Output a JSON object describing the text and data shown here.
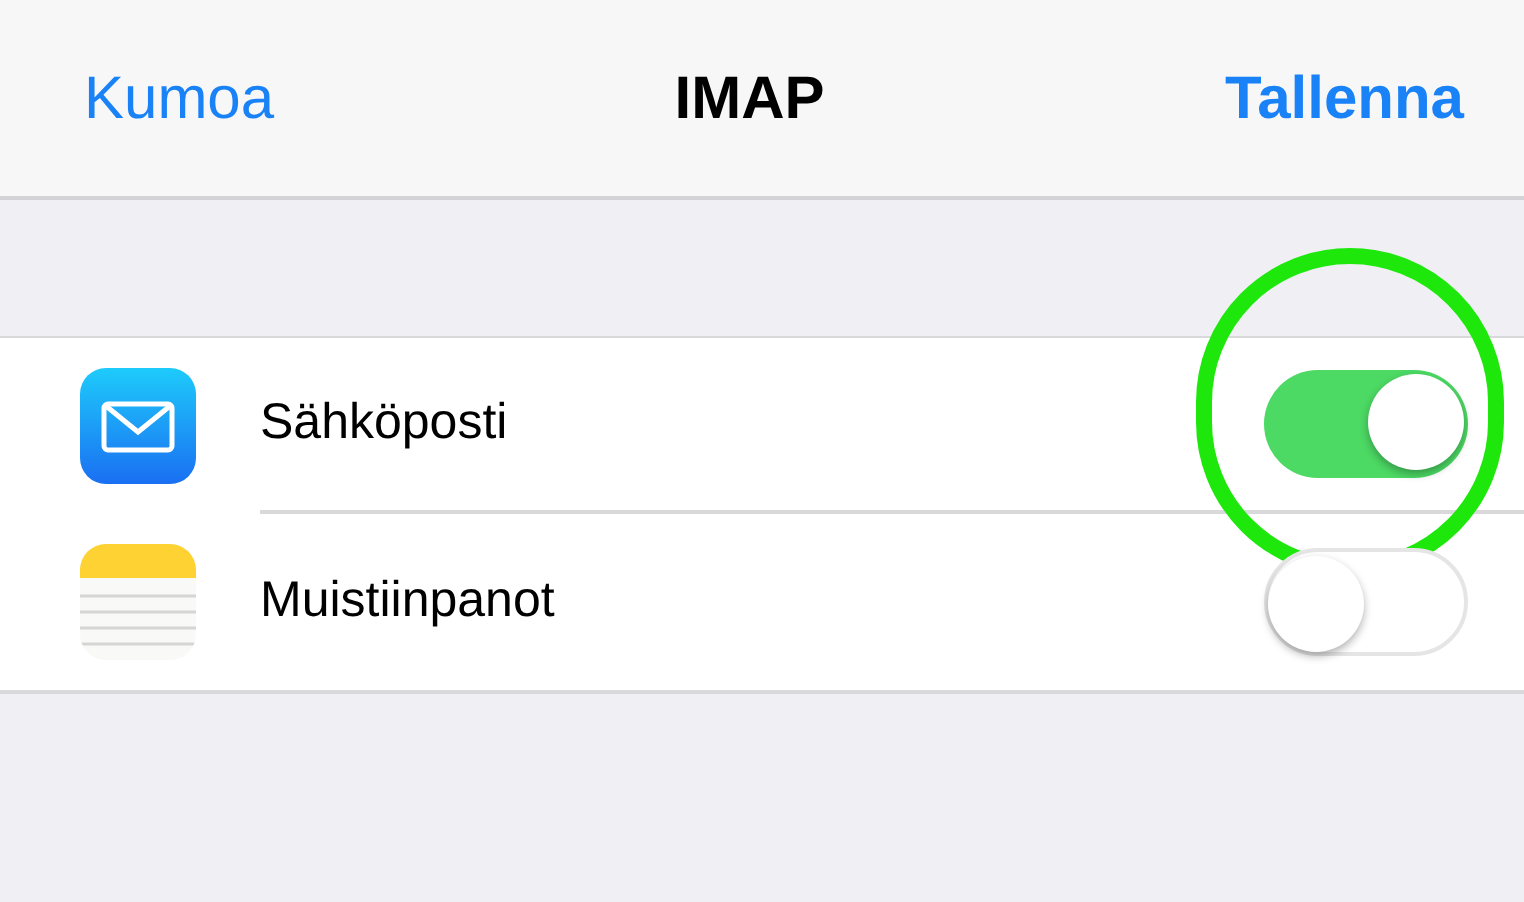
{
  "nav_bar": {
    "cancel": "Kumoa",
    "title": "IMAP",
    "save": "Tallenna"
  },
  "rows": [
    {
      "kind": "mail",
      "label": "Sähköposti",
      "on": true,
      "highlighted": true
    },
    {
      "kind": "notes",
      "label": "Muistiinpanot",
      "on": false,
      "highlighted": false
    }
  ]
}
